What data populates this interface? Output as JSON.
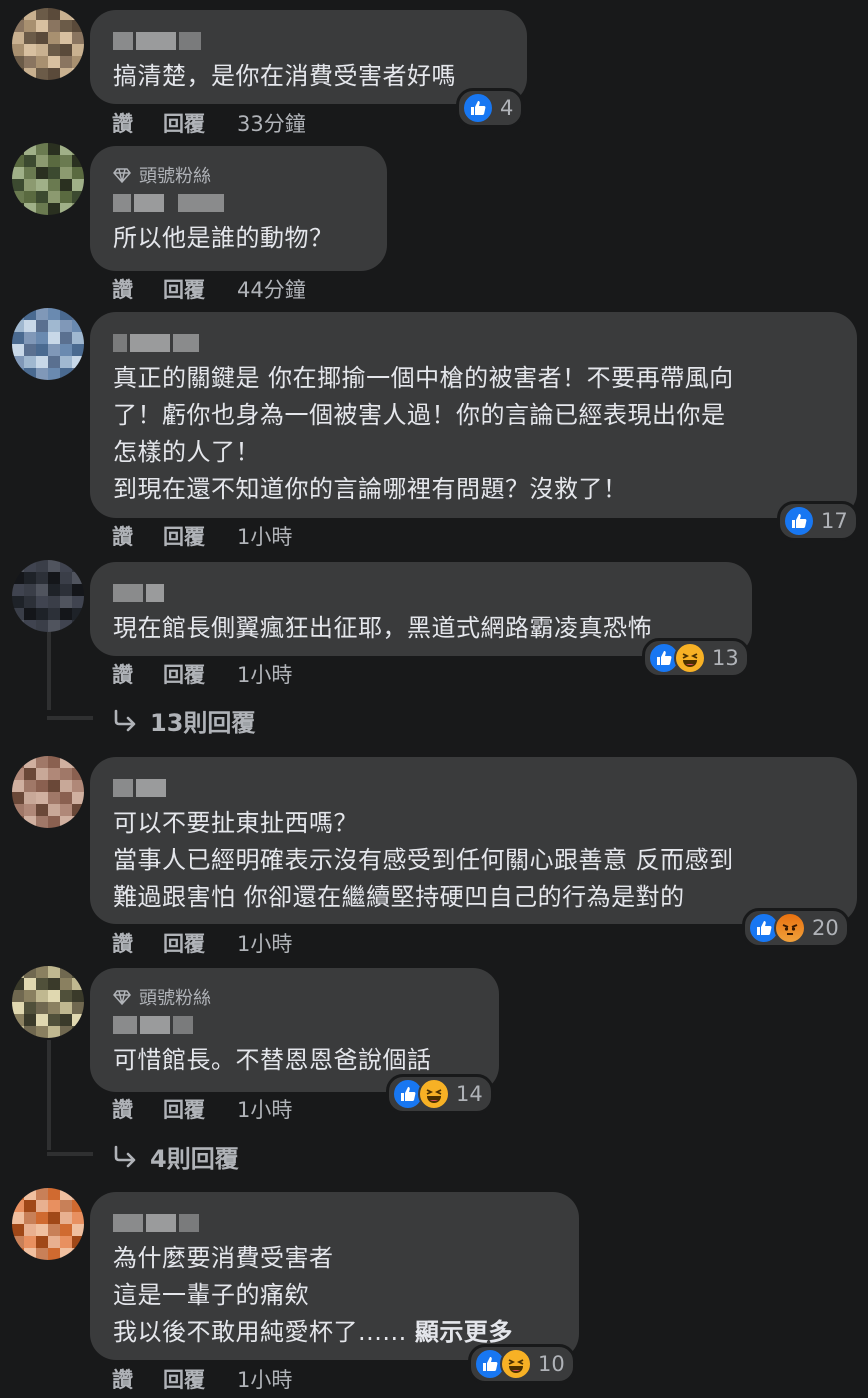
{
  "comments": [
    {
      "fan_badge": "",
      "text": "搞清楚，是你在消費受害者好嗎",
      "reactions": [
        "like"
      ],
      "reaction_count": "4",
      "actions": {
        "like": "讚",
        "reply": "回覆"
      },
      "time": "33分鐘"
    },
    {
      "fan_badge": "頭號粉絲",
      "text": "所以他是誰的動物？",
      "reactions": [],
      "reaction_count": "",
      "actions": {
        "like": "讚",
        "reply": "回覆"
      },
      "time": "44分鐘"
    },
    {
      "fan_badge": "",
      "text": "真正的關鍵是 你在揶揄一個中槍的被害者！不要再帶風向\n了！虧你也身為一個被害人過！你的言論已經表現出你是\n怎樣的人了！\n到現在還不知道你的言論哪裡有問題？沒救了！",
      "reactions": [
        "like"
      ],
      "reaction_count": "17",
      "actions": {
        "like": "讚",
        "reply": "回覆"
      },
      "time": "1小時"
    },
    {
      "fan_badge": "",
      "text": "現在館長側翼瘋狂出征耶，黑道式網路霸凌真恐怖",
      "reactions": [
        "like",
        "haha"
      ],
      "reaction_count": "13",
      "actions": {
        "like": "讚",
        "reply": "回覆"
      },
      "time": "1小時",
      "replies_label": "13則回覆"
    },
    {
      "fan_badge": "",
      "text": "可以不要扯東扯西嗎？\n當事人已經明確表示沒有感受到任何關心跟善意 反而感到\n難過跟害怕 你卻還在繼續堅持硬凹自己的行為是對的",
      "reactions": [
        "like",
        "angry"
      ],
      "reaction_count": "20",
      "actions": {
        "like": "讚",
        "reply": "回覆"
      },
      "time": "1小時"
    },
    {
      "fan_badge": "頭號粉絲",
      "text": "可惜館長。不替恩恩爸說個話",
      "reactions": [
        "like",
        "haha"
      ],
      "reaction_count": "14",
      "actions": {
        "like": "讚",
        "reply": "回覆"
      },
      "time": "1小時",
      "replies_label": "4則回覆"
    },
    {
      "fan_badge": "",
      "text": "為什麼要消費受害者\n這是一輩子的痛欸\n我以後不敢用純愛杯了......",
      "see_more": "顯示更多",
      "reactions": [
        "like",
        "haha"
      ],
      "reaction_count": "10",
      "actions": {
        "like": "讚",
        "reply": "回覆"
      },
      "time": "1小時"
    }
  ],
  "colors": {
    "background": "#18191a",
    "bubble": "#3a3b3c",
    "text": "#e4e6eb",
    "secondary": "#b0b3b8",
    "like_blue": "#1877f2",
    "haha_yellow": "#f7b125",
    "angry_orange": "#e9710f"
  },
  "icons": {
    "fan_badge": "diamond-icon",
    "replies": "reply-arrow-icon",
    "reactions": [
      "like-reaction-icon",
      "haha-reaction-icon",
      "angry-reaction-icon"
    ]
  }
}
